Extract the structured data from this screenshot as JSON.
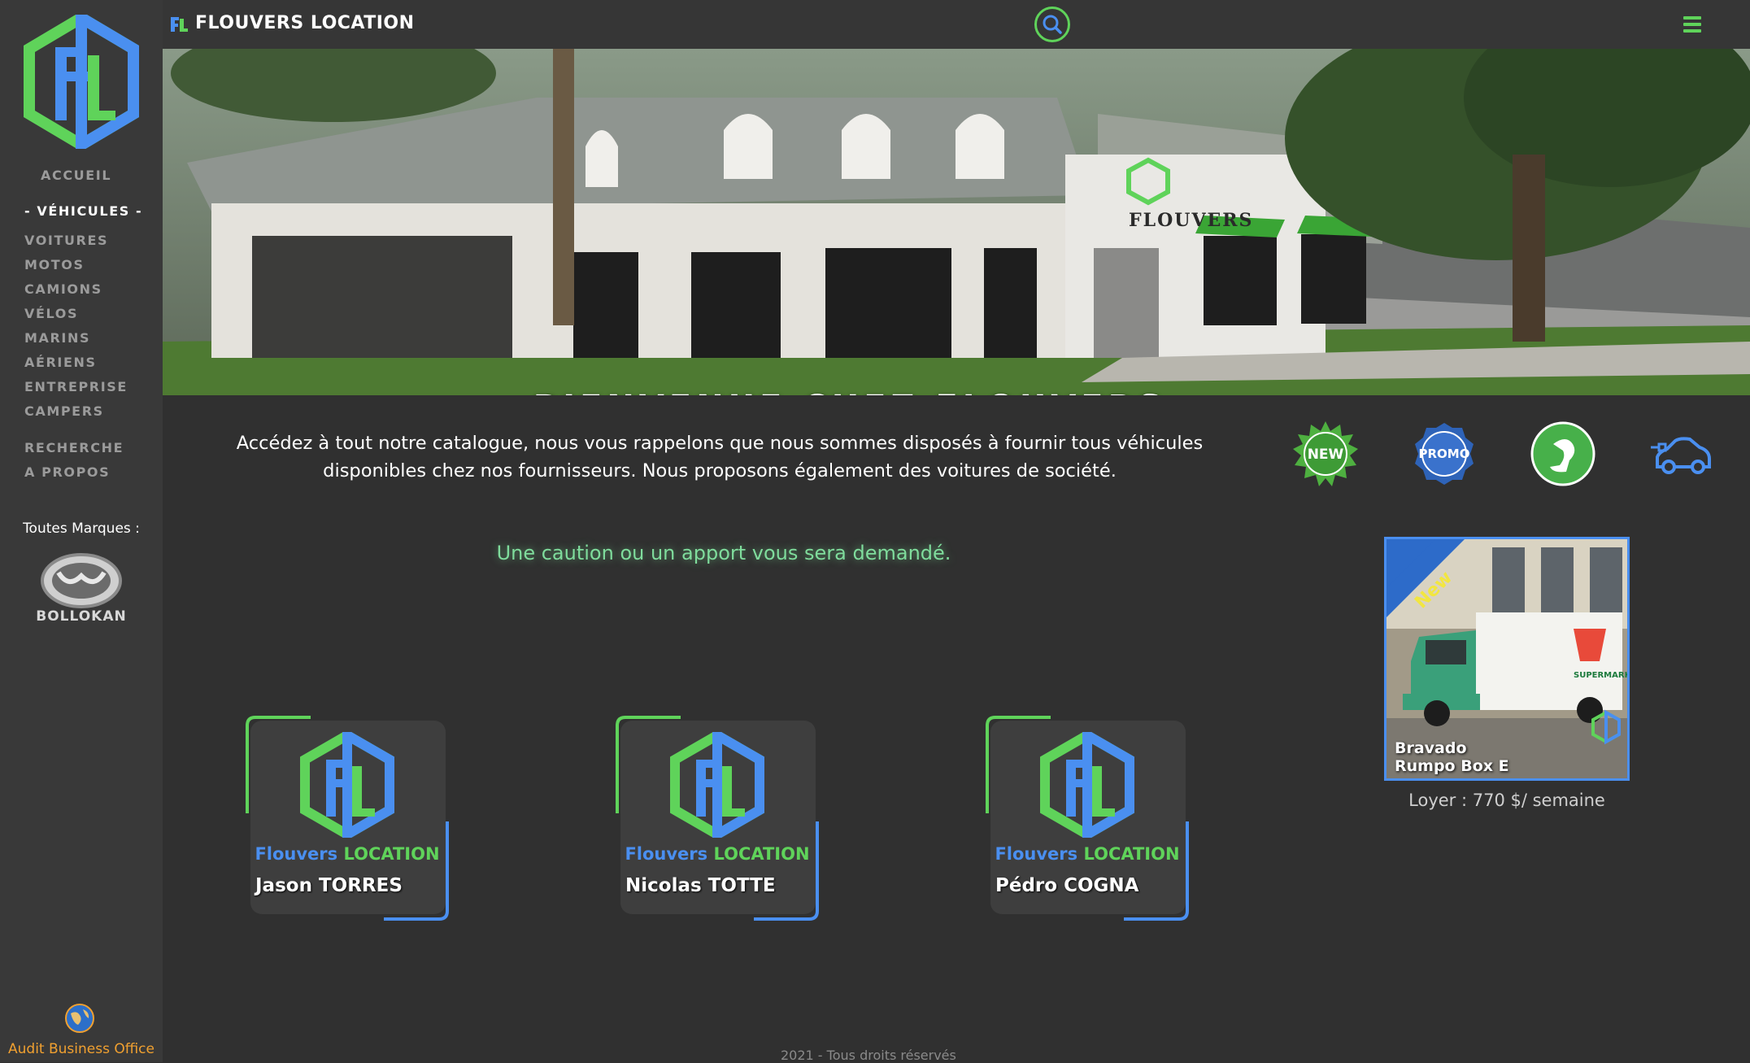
{
  "sidebar": {
    "nav": [
      {
        "label": "ACCUEIL",
        "active": false
      },
      {
        "label": "- VÉHICULES -",
        "active": true
      },
      {
        "label": "VOITURES",
        "active": false
      },
      {
        "label": "MOTOS",
        "active": false
      },
      {
        "label": "CAMIONS",
        "active": false
      },
      {
        "label": "VÉLOS",
        "active": false
      },
      {
        "label": "MARINS",
        "active": false
      },
      {
        "label": "AÉRIENS",
        "active": false
      },
      {
        "label": "ENTREPRISE",
        "active": false
      },
      {
        "label": "CAMPERS",
        "active": false
      },
      {
        "label": "RECHERCHE",
        "active": false
      },
      {
        "label": "A PROPOS",
        "active": false
      }
    ],
    "brands_label": "Toutes Marques :",
    "brand_name": "BOLLOKAN",
    "audit_label": "Audit Business Office"
  },
  "topbar": {
    "title": "FLOUVERS LOCATION",
    "search_icon": "search-icon",
    "menu_icon": "hamburger-menu-icon"
  },
  "banner": {
    "title": "BIENVENUE CHEZ FLOUVERS",
    "sign_text": "FLOUVERS"
  },
  "intro": "Accédez à tout notre catalogue, nous vous rappelons que nous sommes disposés à fournir tous véhicules disponibles chez nos fournisseurs. Nous proposons également des voitures de société.",
  "caution": "Une caution ou un apport vous sera demandé.",
  "badges": [
    {
      "icon": "new-badge-icon",
      "label": "NEW"
    },
    {
      "icon": "promo-badge-icon",
      "label": "PROMO"
    },
    {
      "icon": "jerrican-icon",
      "label": ""
    },
    {
      "icon": "electric-car-icon",
      "label": ""
    }
  ],
  "agents": {
    "brand_blue": "Flouvers",
    "brand_green": "LOCATION",
    "names": [
      "Jason TORRES",
      "Nicolas TOTTE",
      "Pédro COGNA"
    ]
  },
  "promo": {
    "ribbon": "New",
    "vehicle_line1": "Bravado",
    "vehicle_line2": "Rumpo Box E",
    "truck_text": "SUPERMARKET",
    "rent": "Loyer : 770 $/ semaine"
  },
  "footer": "2021 - Tous droits réservés",
  "colors": {
    "accent_green": "#5fd35a",
    "accent_blue": "#4a8ff0",
    "sidebar_bg": "#393939",
    "page_bg": "#303030",
    "caution_text": "#7fdc9c",
    "audit_text": "#f0a030"
  }
}
